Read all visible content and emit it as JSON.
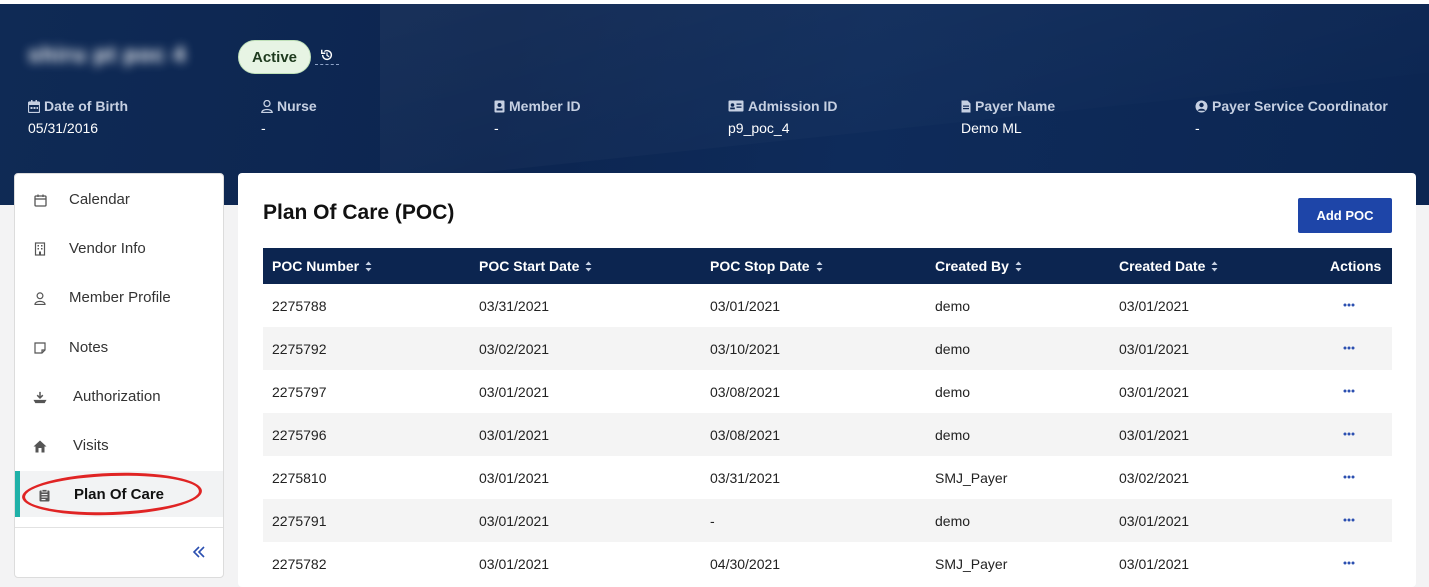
{
  "header": {
    "member_name": "shiru pt poc 4",
    "status": "Active"
  },
  "info": [
    {
      "icon": "calendar-icon",
      "label": "Date of Birth",
      "value": "05/31/2016"
    },
    {
      "icon": "user-icon",
      "label": "Nurse",
      "value": "-"
    },
    {
      "icon": "id-badge-icon",
      "label": "Member ID",
      "value": "-"
    },
    {
      "icon": "id-card-icon",
      "label": "Admission ID",
      "value": "p9_poc_4"
    },
    {
      "icon": "document-icon",
      "label": "Payer Name",
      "value": "Demo ML"
    },
    {
      "icon": "user-circle-icon",
      "label": "Payer Service Coordinator",
      "value": "-"
    }
  ],
  "sidebar": {
    "items": [
      {
        "icon": "calendar-icon",
        "label": "Calendar"
      },
      {
        "icon": "building-icon",
        "label": "Vendor Info"
      },
      {
        "icon": "user-icon",
        "label": "Member Profile"
      },
      {
        "icon": "note-icon",
        "label": "Notes"
      },
      {
        "icon": "authorization-icon",
        "label": "Authorization"
      },
      {
        "icon": "home-icon",
        "label": "Visits"
      },
      {
        "icon": "clipboard-icon",
        "label": "Plan Of Care",
        "active": true
      }
    ],
    "collapse_icon": "double-chevron-left-icon"
  },
  "main": {
    "title": "Plan Of Care (POC)",
    "add_button": "Add POC",
    "columns": [
      "POC Number",
      "POC Start Date",
      "POC Stop Date",
      "Created By",
      "Created Date",
      "Actions"
    ],
    "rows": [
      [
        "2275788",
        "03/31/2021",
        "03/01/2021",
        "demo",
        "03/01/2021"
      ],
      [
        "2275792",
        "03/02/2021",
        "03/10/2021",
        "demo",
        "03/01/2021"
      ],
      [
        "2275797",
        "03/01/2021",
        "03/08/2021",
        "demo",
        "03/01/2021"
      ],
      [
        "2275796",
        "03/01/2021",
        "03/08/2021",
        "demo",
        "03/01/2021"
      ],
      [
        "2275810",
        "03/01/2021",
        "03/31/2021",
        "SMJ_Payer",
        "03/02/2021"
      ],
      [
        "2275791",
        "03/01/2021",
        "-",
        "demo",
        "03/01/2021"
      ],
      [
        "2275782",
        "03/01/2021",
        "04/30/2021",
        "SMJ_Payer",
        "03/01/2021"
      ]
    ]
  },
  "colors": {
    "header_bg": "#0c2550",
    "accent_teal": "#1fb1a8",
    "primary_button": "#1e45a8",
    "highlight_ring": "#e02424",
    "status_bg": "#e7f4e4"
  }
}
